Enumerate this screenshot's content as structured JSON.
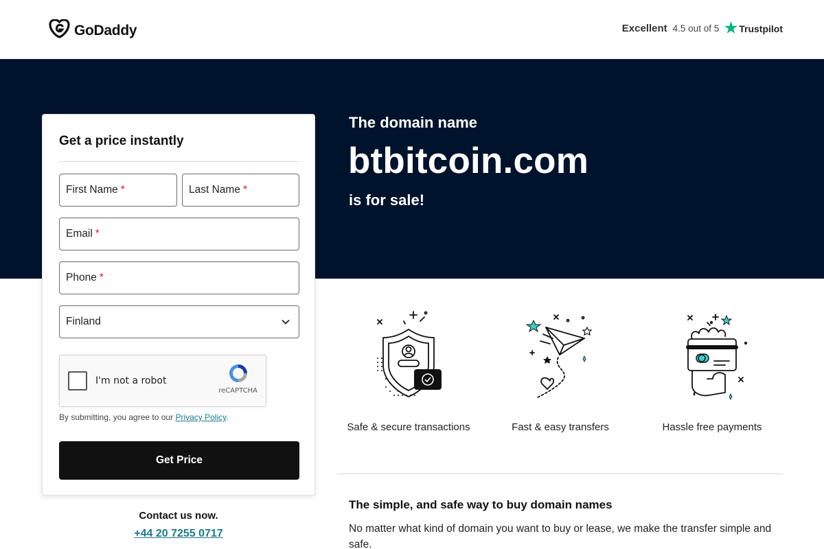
{
  "header": {
    "brand": "GoDaddy",
    "rating_label": "Excellent",
    "rating_score": "4.5 out of 5",
    "rating_source": "Trustpilot",
    "star_color": "#00b67a"
  },
  "hero": {
    "intro": "The domain name",
    "domain": "btbitcoin.com",
    "sale_text": "is for sale!",
    "background": "#00132d"
  },
  "form": {
    "title": "Get a price instantly",
    "first_name": "First Name",
    "last_name": "Last Name",
    "email": "Email",
    "phone": "Phone",
    "required_mark": "*",
    "country": "Finland",
    "captcha_label": "I'm not a robot",
    "captcha_brand": "reCAPTCHA",
    "consent_prefix": "By submitting, you agree to our",
    "privacy_link": "Privacy Policy",
    "consent_suffix": ".",
    "submit": "Get Price"
  },
  "contact": {
    "heading": "Contact us now.",
    "phone": "+44 20 7255 0717"
  },
  "features": [
    {
      "icon": "shield-user-icon",
      "label": "Safe & secure transactions"
    },
    {
      "icon": "paper-plane-icon",
      "label": "Fast & easy transfers"
    },
    {
      "icon": "card-hand-icon",
      "label": "Hassle free payments"
    }
  ],
  "info": {
    "title": "The simple, and safe way to buy domain names",
    "text": "No matter what kind of domain you want to buy or lease, we make the transfer simple and safe."
  },
  "colors": {
    "accent_teal": "#1b7a8c",
    "required_red": "#d71920",
    "button_black": "#111111"
  }
}
